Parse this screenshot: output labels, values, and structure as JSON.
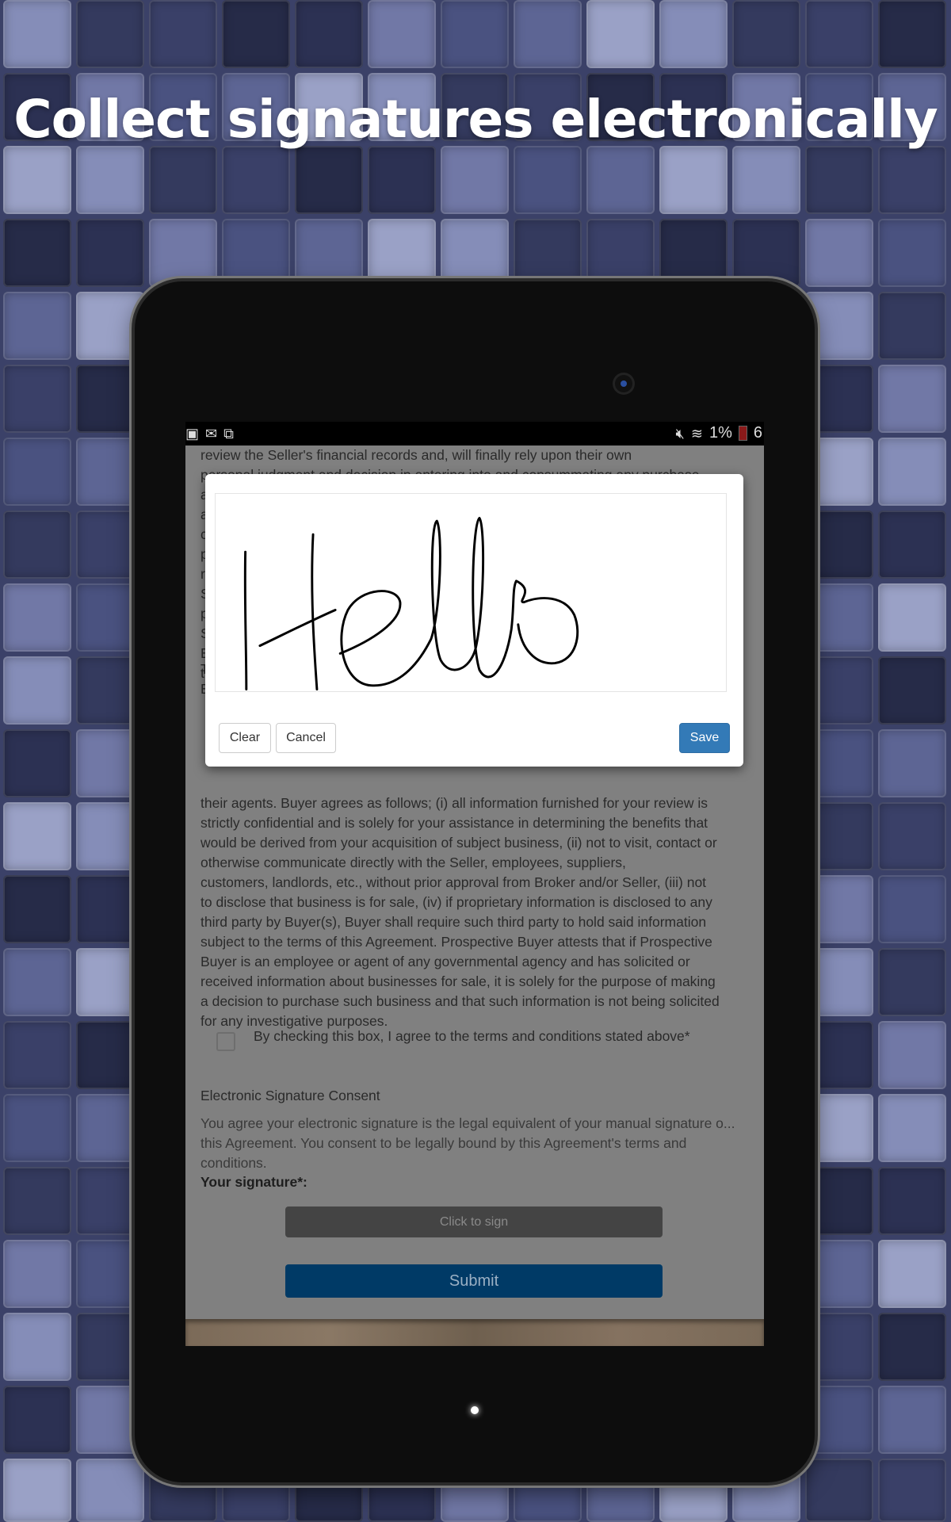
{
  "headline": "Collect signatures electronically",
  "status_bar": {
    "left_icons": [
      "gallery-icon",
      "gmail-icon",
      "screenshot-icon"
    ],
    "right_icons": [
      "mute-icon",
      "wifi-icon",
      "battery-icon"
    ],
    "battery_percent": "1%",
    "clock_partial": "6"
  },
  "document": {
    "top_lines": [
      "review the Seller's financial records and, will finally rely upon their own",
      "personal judgment and decision in entering into and consummating any purchase"
    ],
    "hidden_line_initials": [
      "a",
      "a",
      "c",
      "p",
      "r",
      "S",
      "p",
      "S",
      "E",
      "t"
    ],
    "middle_initials": [
      "T",
      "E"
    ],
    "lines": [
      "their agents.  Buyer agrees as follows; (i) all information furnished for your review is",
      "strictly confidential and is solely for your assistance in determining the benefits that",
      "would be derived from your acquisition of subject business,  (ii) not to visit, contact or",
      "otherwise communicate directly with the Seller, employees, suppliers,",
      "customers, landlords, etc., without prior approval from Broker and/or Seller, (iii) not",
      "to disclose that business is for sale, (iv) if proprietary information is disclosed to any",
      "third party by Buyer(s), Buyer shall require such third party to hold said information",
      "subject to the terms of this Agreement. Prospective Buyer attests that if Prospective",
      "Buyer is an employee or agent of any governmental agency and has solicited or",
      "received information about businesses for sale, it is solely for the purpose of making",
      "a decision to purchase such business and that such information is not being solicited",
      "for any investigative purposes."
    ],
    "agree_checkbox_label": "By checking this box, I agree to the terms and conditions stated above*",
    "agree_checked": false,
    "consent_title": "Electronic Signature Consent",
    "consent_lines": [
      "You agree your electronic signature is the legal equivalent of your manual signature o...",
      "this Agreement. You consent to be legally bound by this Agreement's terms and",
      "conditions."
    ],
    "signature_label": "Your signature*:",
    "click_to_sign": "Click to sign",
    "submit": "Submit"
  },
  "signature_modal": {
    "signature_ink": "Hello",
    "clear": "Clear",
    "cancel": "Cancel",
    "save": "Save"
  },
  "colors": {
    "save_button": "#337ab7",
    "submit_button": "#003a66",
    "background_tiles": "#3b4168"
  }
}
